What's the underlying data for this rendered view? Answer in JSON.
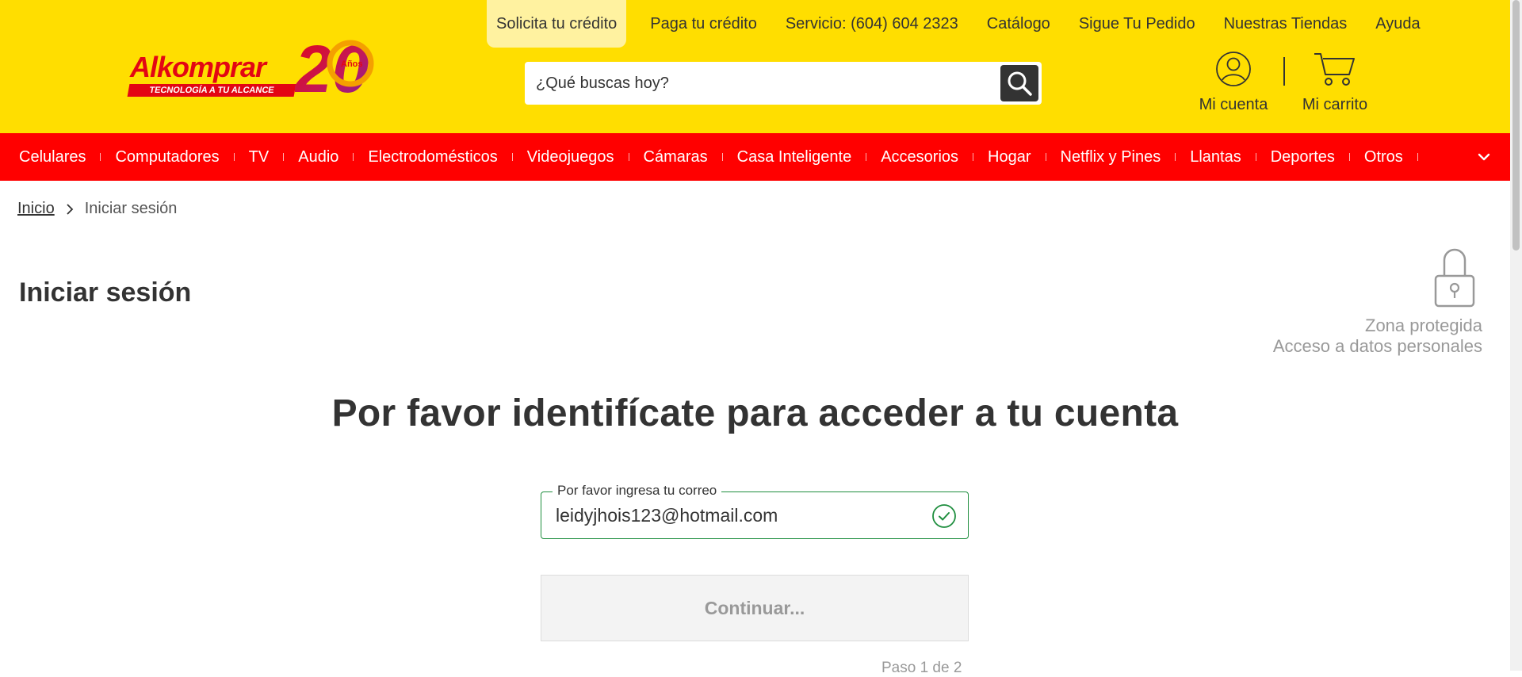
{
  "brand": {
    "wordmark": "Alkomprar",
    "tagline": "TECNOLOGÍA A TU ALCANCE",
    "anniversary_number": "20",
    "anniversary_word": "Años",
    "primary_color": "#ffde00",
    "accent_color": "#ff0000"
  },
  "top_links": [
    {
      "label": "Solicita tu crédito",
      "highlight": true
    },
    {
      "label": "Paga tu crédito"
    },
    {
      "label": "Servicio: (604) 604 2323"
    },
    {
      "label": "Catálogo"
    },
    {
      "label": "Sigue Tu Pedido"
    },
    {
      "label": "Nuestras Tiendas"
    },
    {
      "label": "Ayuda"
    }
  ],
  "search": {
    "placeholder": "¿Qué buscas hoy?",
    "icon": "search-icon"
  },
  "account": {
    "label": "Mi cuenta",
    "icon": "user-circle-icon"
  },
  "cart": {
    "label": "Mi carrito",
    "icon": "cart-icon"
  },
  "nav": {
    "items": [
      "Celulares",
      "Computadores",
      "TV",
      "Audio",
      "Electrodomésticos",
      "Videojuegos",
      "Cámaras",
      "Casa Inteligente",
      "Accesorios",
      "Hogar",
      "Netflix y Pines",
      "Llantas",
      "Deportes",
      "Otros"
    ],
    "more_icon": "chevron-down-icon"
  },
  "breadcrumb": {
    "home": "Inicio",
    "current": "Iniciar sesión"
  },
  "page_title": "Iniciar sesión",
  "protected": {
    "line1": "Zona protegida",
    "line2": "Acceso a datos personales",
    "icon": "lock-icon"
  },
  "main": {
    "heading": "Por favor identifícate para acceder a tu cuenta",
    "email_label": "Por favor ingresa tu correo",
    "email_value": "leidyjhois123@hotmail.com",
    "continue_label": "Continuar...",
    "step_text": "Paso 1 de 2",
    "valid_color": "#1e8e3e"
  }
}
